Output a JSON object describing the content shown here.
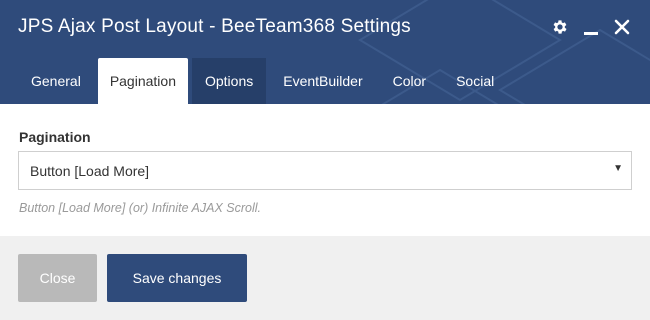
{
  "dialog": {
    "title": "JPS Ajax Post Layout - BeeTeam368 Settings",
    "icons": [
      "gear-icon",
      "minimize-icon",
      "close-icon"
    ]
  },
  "tabs": [
    {
      "label": "General",
      "active": false
    },
    {
      "label": "Pagination",
      "active": true
    },
    {
      "label": "Options",
      "active": false
    },
    {
      "label": "EventBuilder",
      "active": false
    },
    {
      "label": "Color",
      "active": false
    },
    {
      "label": "Social",
      "active": false
    }
  ],
  "pagination_field": {
    "label": "Pagination",
    "value": "Button [Load More]",
    "help": "Button [Load More] (or) Infinite AJAX Scroll."
  },
  "footer": {
    "close_label": "Close",
    "save_label": "Save changes"
  },
  "colors": {
    "header": "#2f4b7b",
    "active_tab_bg": "#ffffff",
    "close_button": "#b9b9b9",
    "save_button": "#2f4b7b",
    "footer_bg": "#f0f0f0"
  }
}
